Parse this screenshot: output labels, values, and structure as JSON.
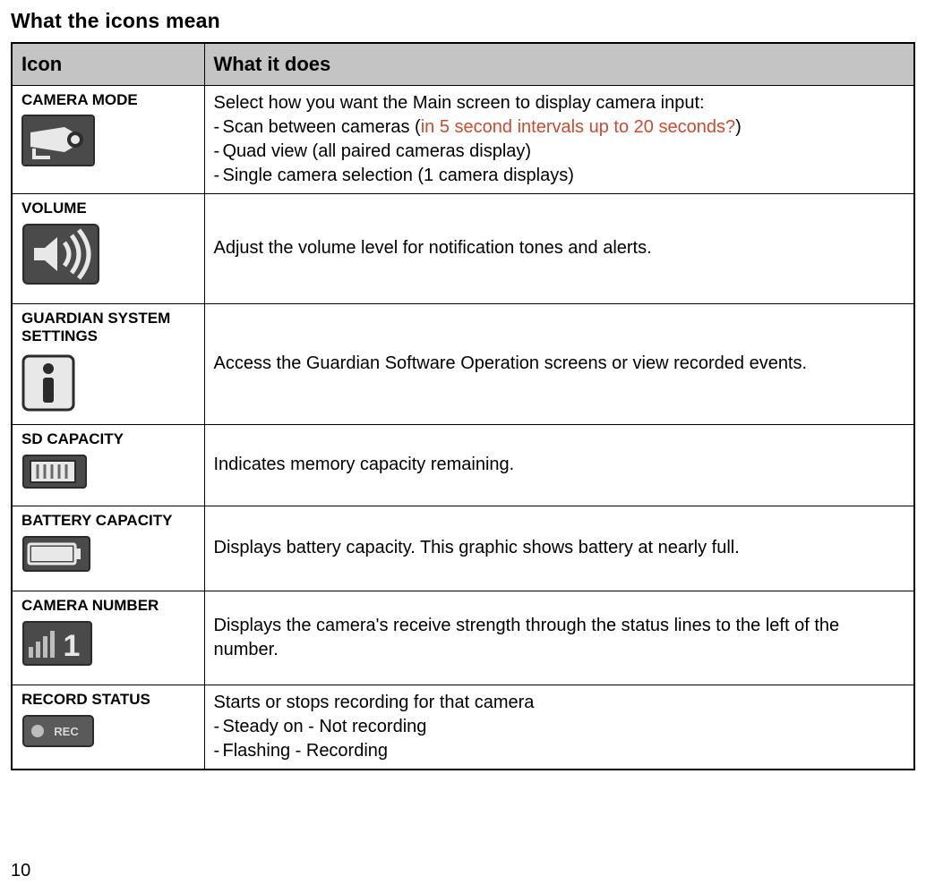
{
  "title": "What the icons mean",
  "page_number": "10",
  "columns": {
    "icon": "Icon",
    "desc": "What it does"
  },
  "rows": {
    "camera_mode": {
      "label": "CAMERA MODE",
      "desc_lead": "Select how you want the Main screen to display camera input:",
      "b1_pre": "Scan between cameras (",
      "b1_red": "in 5 second intervals up to 20 seconds?",
      "b1_post": ")",
      "b2": "Quad view (all paired cameras display)",
      "b3": "Single camera selection (1 camera displays)"
    },
    "volume": {
      "label": "VOLUME",
      "desc": "Adjust the volume level for notification tones and alerts."
    },
    "guardian": {
      "label": "GUARDIAN SYSTEM SETTINGS",
      "desc": "Access the Guardian Software Operation screens or view recorded events."
    },
    "sd": {
      "label": "SD CAPACITY",
      "desc": "Indicates memory capacity remaining."
    },
    "battery": {
      "label": "BATTERY CAPACITY",
      "desc": "Displays battery capacity. This graphic shows battery at nearly full."
    },
    "camera_number": {
      "label": "CAMERA NUMBER",
      "desc": "Displays the camera's receive strength through the status lines to the left of the number."
    },
    "record": {
      "label": "RECORD STATUS",
      "desc_lead": "Starts or stops recording for that camera",
      "b1": "Steady on - Not recording",
      "b2": "Flashing - Recording"
    }
  }
}
